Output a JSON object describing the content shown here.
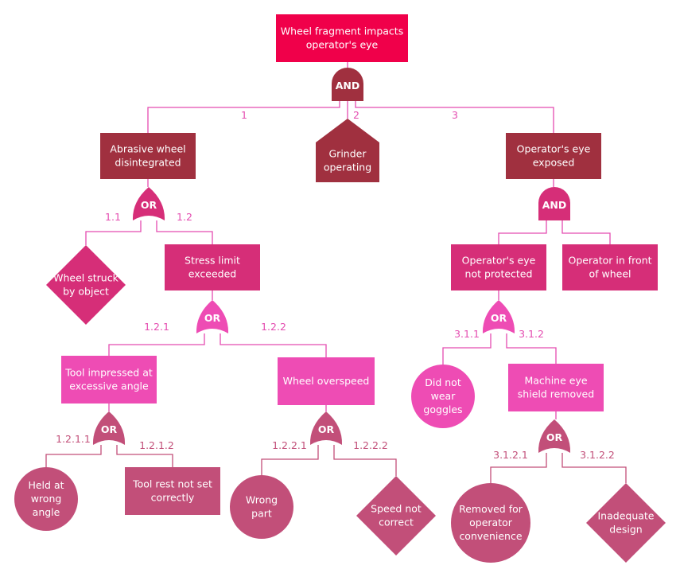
{
  "diagram": {
    "title": "Wheel fragment impacts operator's eye",
    "colors": {
      "top": "#f0004a",
      "level1": "#a0303f",
      "level2": "#d62e78",
      "level3": "#ee4cb4",
      "level4": "#c24f79",
      "connector_pink": "#e44cb0",
      "connector_dark": "#c24f79",
      "label_pink": "#e44cb0",
      "label_dark": "#c24f79"
    },
    "nodes": [
      {
        "id": "top",
        "shape": "rect",
        "lines": [
          "Wheel fragment impacts",
          "operator's eye"
        ],
        "color": "top"
      },
      {
        "id": "n1",
        "shape": "rect",
        "lines": [
          "Abrasive wheel",
          "disintegrated"
        ],
        "color": "level1"
      },
      {
        "id": "n2",
        "shape": "house",
        "lines": [
          "Grinder",
          "operating"
        ],
        "color": "level1"
      },
      {
        "id": "n3",
        "shape": "rect",
        "lines": [
          "Operator's eye",
          "exposed"
        ],
        "color": "level1"
      },
      {
        "id": "n11",
        "shape": "diamond",
        "lines": [
          "Wheel struck",
          "by object"
        ],
        "color": "level2"
      },
      {
        "id": "n12",
        "shape": "rect",
        "lines": [
          "Stress limit",
          "exceeded"
        ],
        "color": "level2"
      },
      {
        "id": "n31",
        "shape": "rect",
        "lines": [
          "Operator's eye",
          "not protected"
        ],
        "color": "level2"
      },
      {
        "id": "n32",
        "shape": "rect",
        "lines": [
          "Operator in front",
          "of wheel"
        ],
        "color": "level2"
      },
      {
        "id": "n121",
        "shape": "rect",
        "lines": [
          "Tool impressed at",
          "excessive angle"
        ],
        "color": "level3"
      },
      {
        "id": "n122",
        "shape": "rect",
        "lines": [
          "Wheel overspeed"
        ],
        "color": "level3"
      },
      {
        "id": "n311",
        "shape": "circle",
        "lines": [
          "Did not",
          "wear",
          "goggles"
        ],
        "color": "level3"
      },
      {
        "id": "n312",
        "shape": "rect",
        "lines": [
          "Machine eye",
          "shield removed"
        ],
        "color": "level3"
      },
      {
        "id": "n1211",
        "shape": "circle",
        "lines": [
          "Held at",
          "wrong",
          "angle"
        ],
        "color": "level4"
      },
      {
        "id": "n1212",
        "shape": "rect",
        "lines": [
          "Tool rest not set",
          "correctly"
        ],
        "color": "level4"
      },
      {
        "id": "n1221",
        "shape": "circle",
        "lines": [
          "Wrong",
          "part"
        ],
        "color": "level4"
      },
      {
        "id": "n1222",
        "shape": "diamond",
        "lines": [
          "Speed not",
          "correct"
        ],
        "color": "level4"
      },
      {
        "id": "n3121",
        "shape": "circle",
        "lines": [
          "Removed for",
          "operator",
          "convenience"
        ],
        "color": "level4"
      },
      {
        "id": "n3122",
        "shape": "diamond",
        "lines": [
          "Inadequate",
          "design"
        ],
        "color": "level4"
      }
    ],
    "gates": [
      {
        "id": "g_top",
        "type": "AND",
        "label": "AND",
        "color": "level1"
      },
      {
        "id": "g1",
        "type": "OR",
        "label": "OR",
        "color": "level2"
      },
      {
        "id": "g3",
        "type": "AND",
        "label": "AND",
        "color": "level2"
      },
      {
        "id": "g12",
        "type": "OR",
        "label": "OR",
        "color": "level3"
      },
      {
        "id": "g31",
        "type": "OR",
        "label": "OR",
        "color": "level3"
      },
      {
        "id": "g121",
        "type": "OR",
        "label": "OR",
        "color": "level4"
      },
      {
        "id": "g122",
        "type": "OR",
        "label": "OR",
        "color": "level4"
      },
      {
        "id": "g312",
        "type": "OR",
        "label": "OR",
        "color": "level4"
      }
    ],
    "edge_labels": [
      {
        "id": "e1",
        "text": "1",
        "color": "label_pink"
      },
      {
        "id": "e2",
        "text": "2",
        "color": "label_pink"
      },
      {
        "id": "e3",
        "text": "3",
        "color": "label_pink"
      },
      {
        "id": "e11",
        "text": "1.1",
        "color": "label_pink"
      },
      {
        "id": "e12",
        "text": "1.2",
        "color": "label_pink"
      },
      {
        "id": "e121",
        "text": "1.2.1",
        "color": "label_pink"
      },
      {
        "id": "e122",
        "text": "1.2.2",
        "color": "label_pink"
      },
      {
        "id": "e1211",
        "text": "1.2.1.1",
        "color": "label_dark"
      },
      {
        "id": "e1212",
        "text": "1.2.1.2",
        "color": "label_dark"
      },
      {
        "id": "e1221",
        "text": "1.2.2.1",
        "color": "label_dark"
      },
      {
        "id": "e1222",
        "text": "1.2.2.2",
        "color": "label_dark"
      },
      {
        "id": "e311",
        "text": "3.1.1",
        "color": "label_pink"
      },
      {
        "id": "e312",
        "text": "3.1.2",
        "color": "label_pink"
      },
      {
        "id": "e3121",
        "text": "3.1.2.1",
        "color": "label_dark"
      },
      {
        "id": "e3122",
        "text": "3.1.2.2",
        "color": "label_dark"
      }
    ]
  }
}
